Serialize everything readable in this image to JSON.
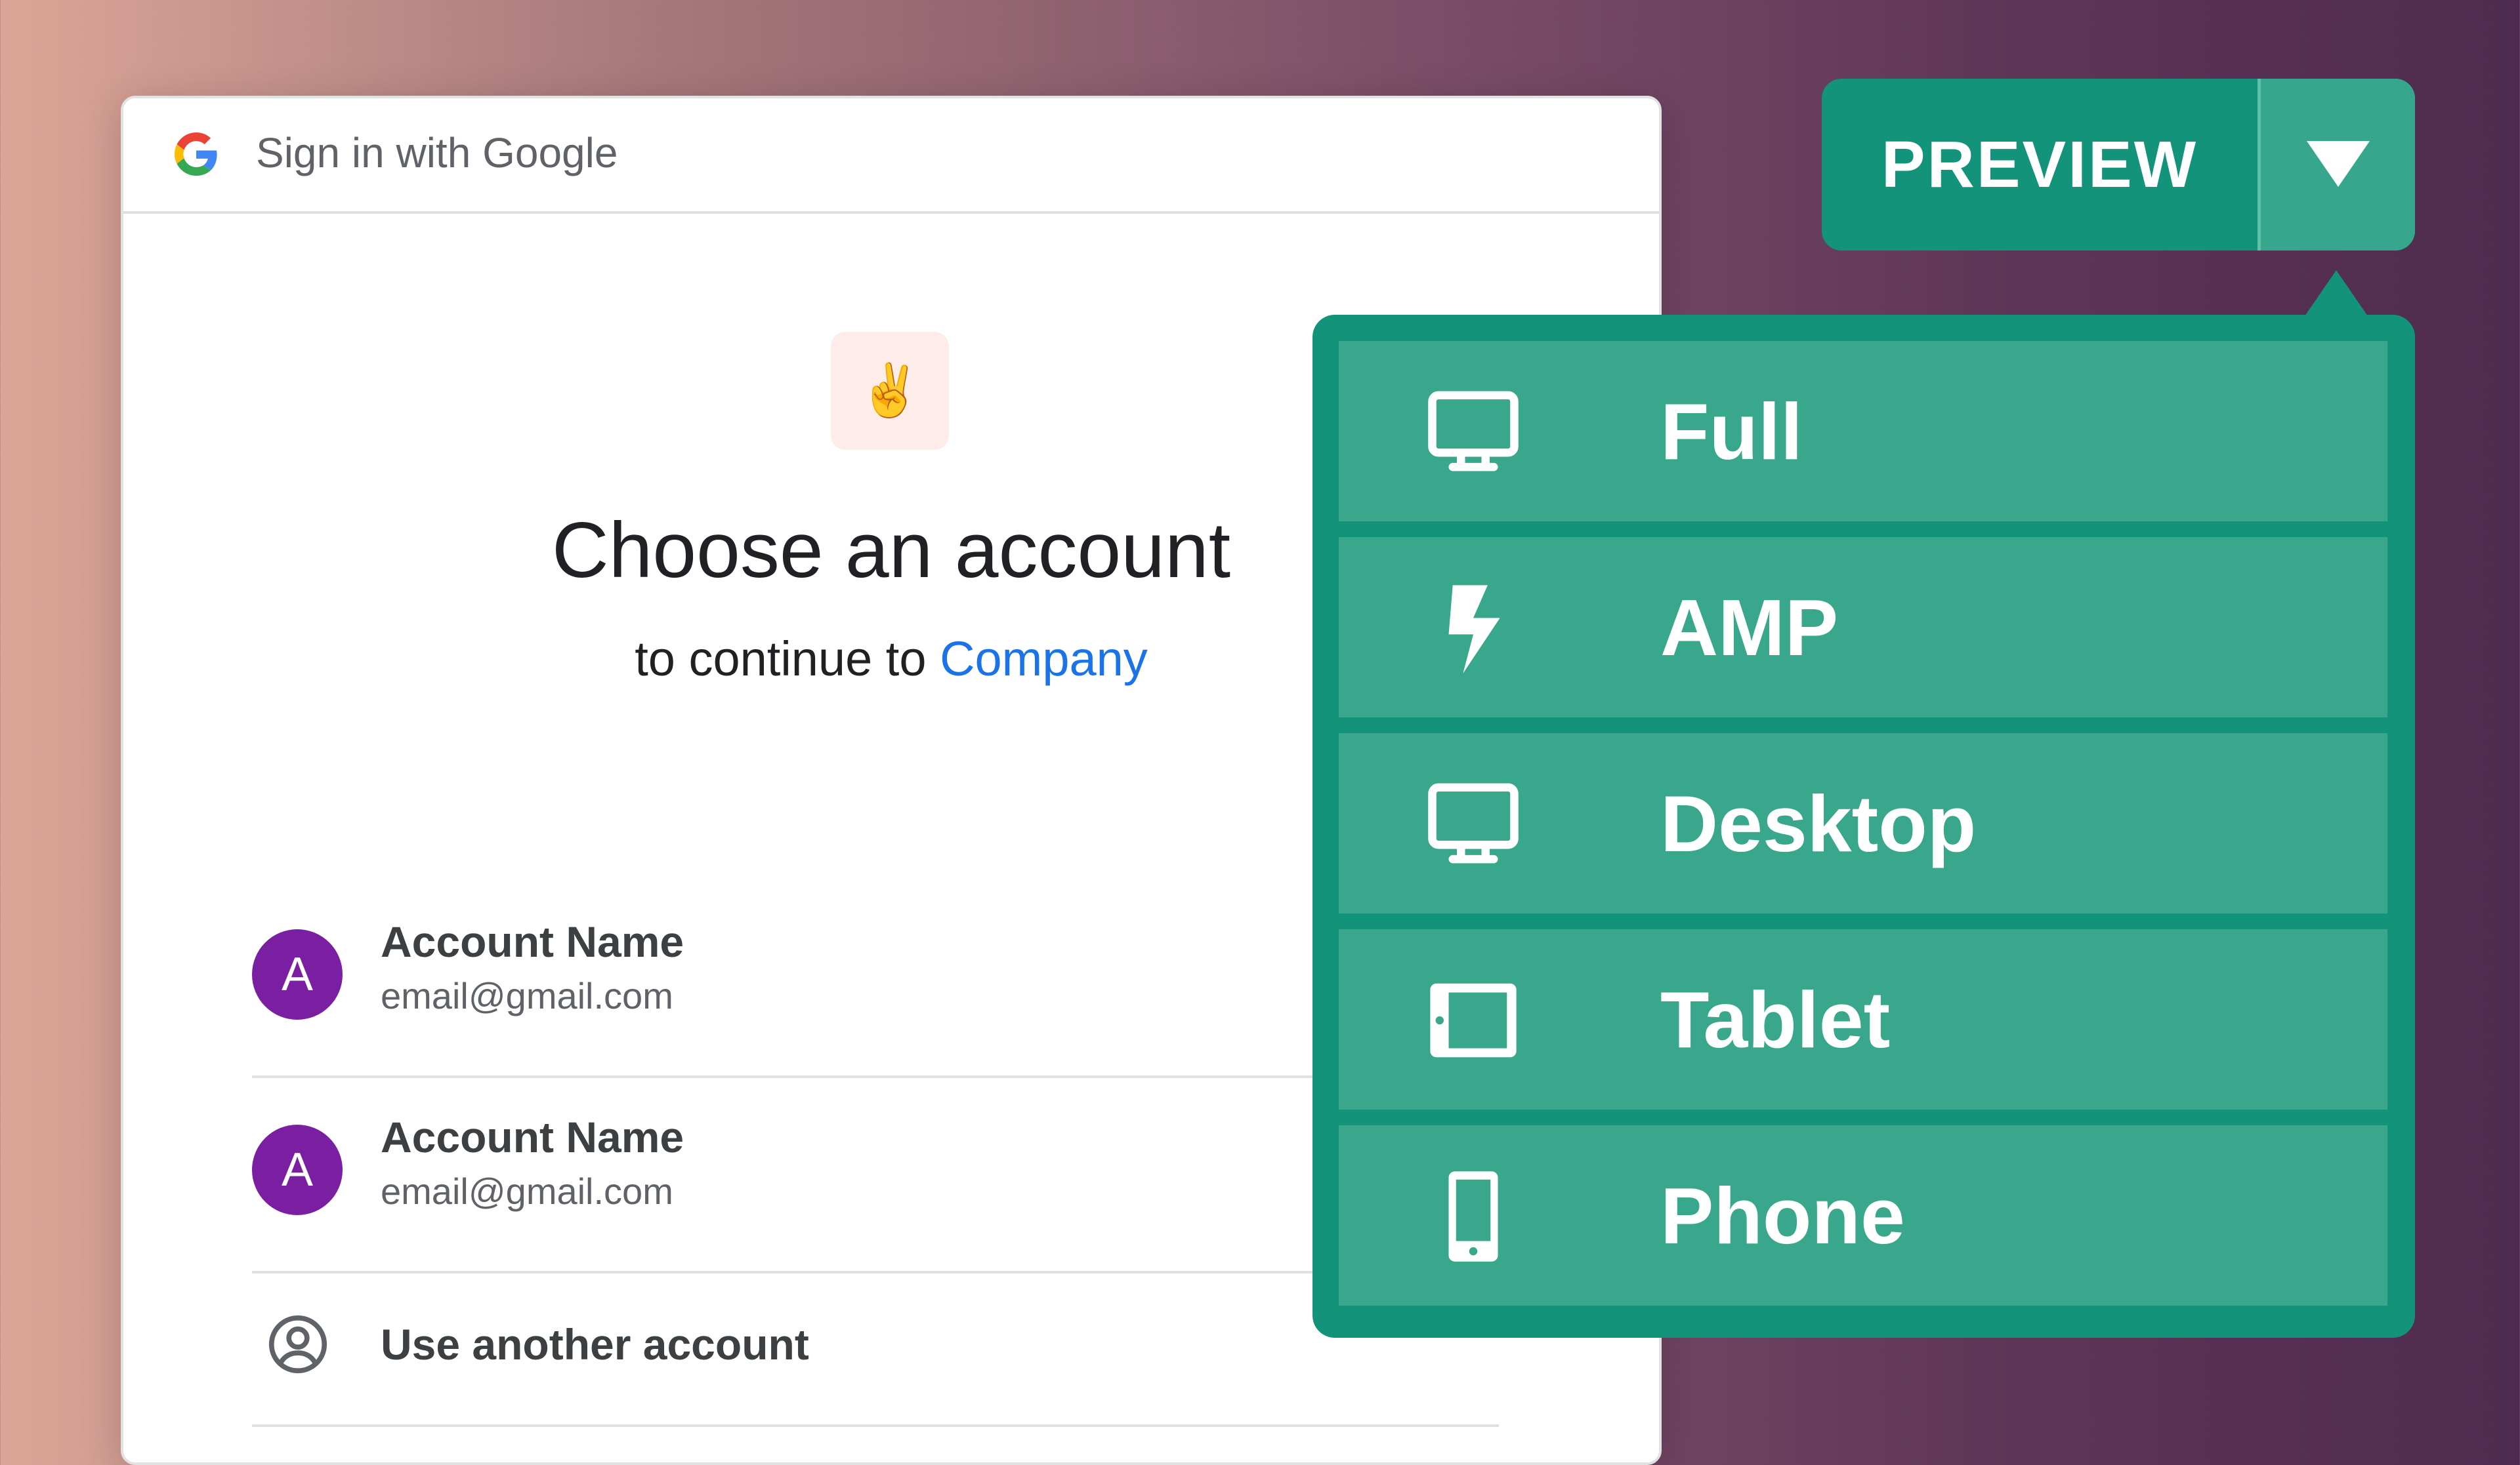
{
  "signin": {
    "header_title": "Sign in with Google",
    "emoji": "✌️",
    "title": "Choose an account",
    "subtitle_prefix": "to continue to ",
    "subtitle_link": "Company",
    "accounts": [
      {
        "initial": "A",
        "name": "Account Name",
        "email": "email@gmail.com"
      },
      {
        "initial": "A",
        "name": "Account Name",
        "email": "email@gmail.com"
      }
    ],
    "another_account": "Use another account"
  },
  "preview": {
    "label": "PREVIEW",
    "menu": [
      {
        "label": "Full",
        "icon": "monitor-icon"
      },
      {
        "label": "AMP",
        "icon": "lightning-icon"
      },
      {
        "label": "Desktop",
        "icon": "monitor-icon"
      },
      {
        "label": "Tablet",
        "icon": "tablet-icon"
      },
      {
        "label": "Phone",
        "icon": "phone-icon"
      }
    ]
  },
  "colors": {
    "accent_green": "#12937a",
    "menu_item_green": "#38a78c",
    "avatar_purple": "#7b1fa2",
    "link_blue": "#1a73e8"
  }
}
